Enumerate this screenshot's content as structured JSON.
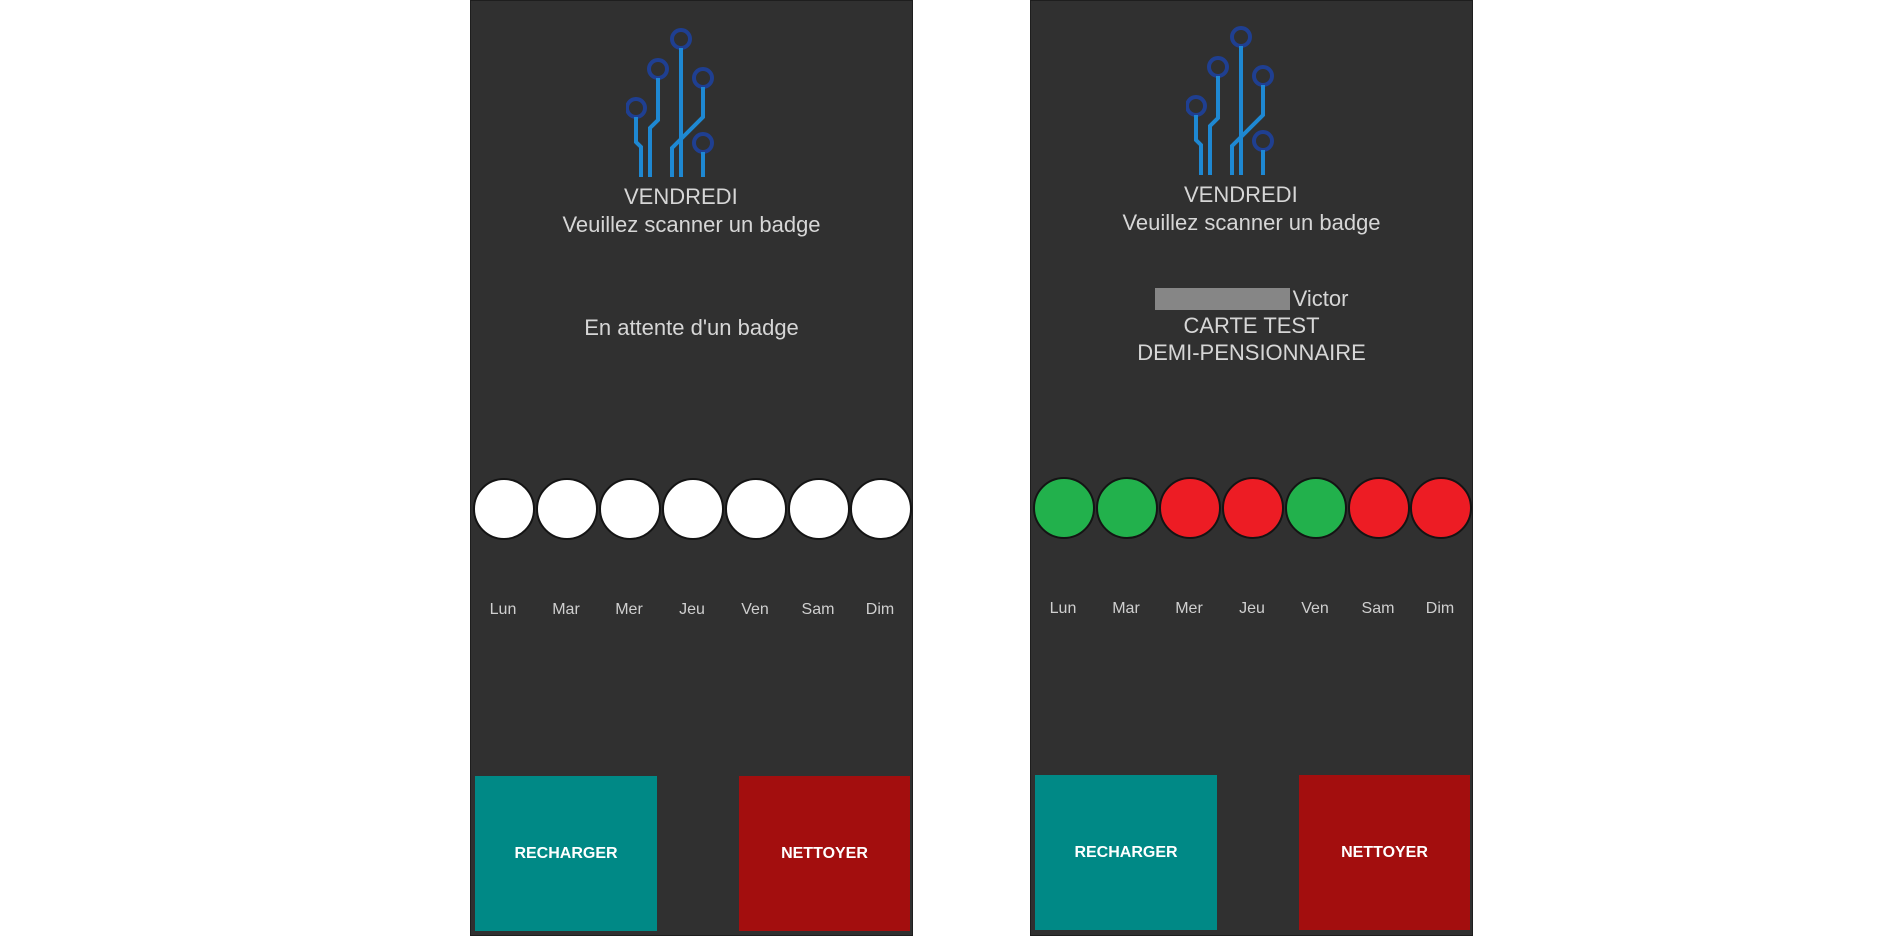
{
  "colors": {
    "background": "#303030",
    "text": "#d6d6d6",
    "reload_button": "#008986",
    "clean_button": "#a30e0e",
    "dot_empty": "#ffffff",
    "dot_green": "#22b14c",
    "dot_red": "#ed1c24",
    "logo_dark": "#1f3f91",
    "logo_light": "#1e88d2"
  },
  "screens": [
    {
      "day": "VENDREDI",
      "instruction": "Veuillez scanner un badge",
      "status": "En attente d'un badge",
      "days": [
        {
          "label": "Lun",
          "state": "empty"
        },
        {
          "label": "Mar",
          "state": "empty"
        },
        {
          "label": "Mer",
          "state": "empty"
        },
        {
          "label": "Jeu",
          "state": "empty"
        },
        {
          "label": "Ven",
          "state": "empty"
        },
        {
          "label": "Sam",
          "state": "empty"
        },
        {
          "label": "Dim",
          "state": "empty"
        }
      ],
      "reload_label": "RECHARGER",
      "clean_label": "NETTOYER"
    },
    {
      "day": "VENDREDI",
      "instruction": "Veuillez scanner un badge",
      "first_name": "Victor",
      "card": "CARTE TEST",
      "regime": "DEMI-PENSIONNAIRE",
      "days": [
        {
          "label": "Lun",
          "state": "green"
        },
        {
          "label": "Mar",
          "state": "green"
        },
        {
          "label": "Mer",
          "state": "red"
        },
        {
          "label": "Jeu",
          "state": "red"
        },
        {
          "label": "Ven",
          "state": "green"
        },
        {
          "label": "Sam",
          "state": "red"
        },
        {
          "label": "Dim",
          "state": "red"
        }
      ],
      "reload_label": "RECHARGER",
      "clean_label": "NETTOYER"
    }
  ]
}
